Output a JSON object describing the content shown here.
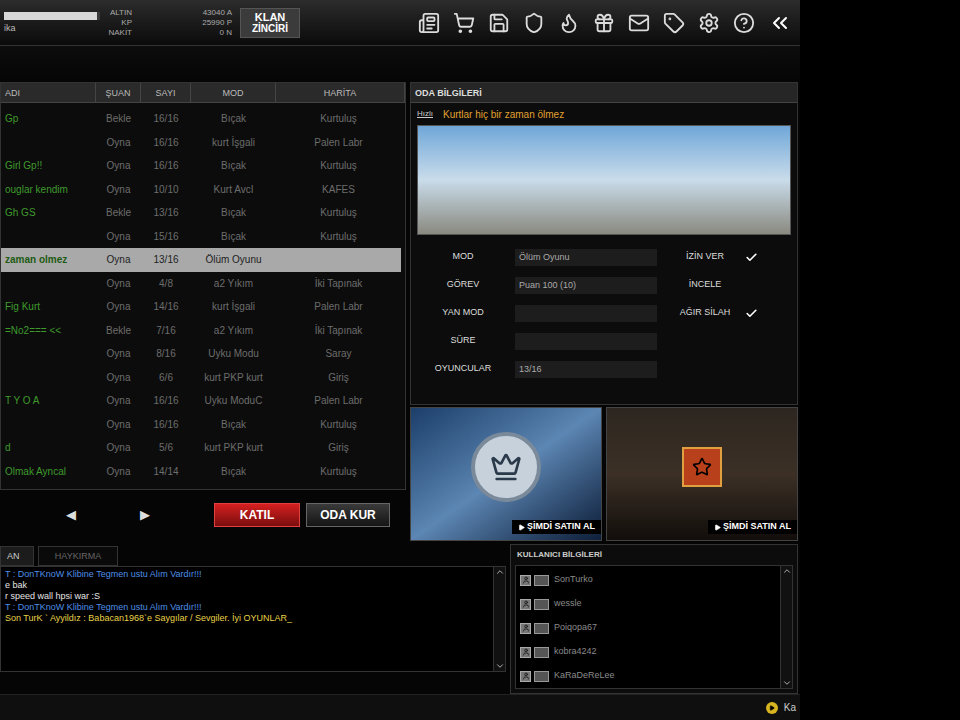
{
  "top_bar": {
    "player_name": "ika",
    "exp_bar": {
      "level": 0.97
    },
    "currencies": [
      {
        "label": "ALTIN",
        "value": "43040 A"
      },
      {
        "label": "KP",
        "value": "25990 P"
      },
      {
        "label": "NAKİT",
        "value": "0 N"
      }
    ],
    "logo": {
      "line1": "KLAN",
      "line2": "ZİNCİRİ"
    }
  },
  "room_list": {
    "columns": [
      "ADI",
      "ŞUAN",
      "SAYI",
      "MOD",
      "HARİTA"
    ],
    "rows": [
      {
        "name": "Gp",
        "status": "Bekle",
        "count": "16/16",
        "mode": "Bıçak",
        "map": "Kurtuluş",
        "selected": false
      },
      {
        "name": "",
        "status": "Oyna",
        "count": "16/16",
        "mode": "kurt İşgali",
        "map": "Palen Labr",
        "selected": false
      },
      {
        "name": "Girl Gp!!",
        "status": "Oyna",
        "count": "16/16",
        "mode": "Bıçak",
        "map": "Kurtuluş",
        "selected": false
      },
      {
        "name": "ouglar kendim",
        "status": "Oyna",
        "count": "10/10",
        "mode": "Kurt AvcI",
        "map": "KAFES",
        "selected": false
      },
      {
        "name": "Gh GS",
        "status": "Bekle",
        "count": "13/16",
        "mode": "Bıçak",
        "map": "Kurtuluş",
        "selected": false
      },
      {
        "name": "",
        "status": "Oyna",
        "count": "15/16",
        "mode": "Bıçak",
        "map": "Kurtuluş",
        "selected": false
      },
      {
        "name": "zaman olmez",
        "status": "Oyna",
        "count": "13/16",
        "mode": "Ölüm Oyunu",
        "map": "",
        "selected": true
      },
      {
        "name": "",
        "status": "Oyna",
        "count": "4/8",
        "mode": "a2 Yıkım",
        "map": "İki Tapınak",
        "selected": false
      },
      {
        "name": "Fig Kurt",
        "status": "Oyna",
        "count": "14/16",
        "mode": "kurt İşgali",
        "map": "Palen Labr",
        "selected": false
      },
      {
        "name": "=No2=== <<",
        "status": "Bekle",
        "count": "7/16",
        "mode": "a2 Yıkım",
        "map": "İki Tapınak",
        "selected": false
      },
      {
        "name": "",
        "status": "Oyna",
        "count": "8/16",
        "mode": "Uyku Modu",
        "map": "Saray",
        "selected": false
      },
      {
        "name": "",
        "status": "Oyna",
        "count": "6/6",
        "mode": "kurt PKP kurt",
        "map": "Giriş",
        "selected": false
      },
      {
        "name": "T Y O A",
        "status": "Oyna",
        "count": "16/16",
        "mode": "Uyku ModuC",
        "map": "Palen Labr",
        "selected": false
      },
      {
        "name": "",
        "status": "Oyna",
        "count": "16/16",
        "mode": "Bıçak",
        "map": "Kurtuluş",
        "selected": false
      },
      {
        "name": "d",
        "status": "Oyna",
        "count": "5/6",
        "mode": "kurt PKP kurt",
        "map": "Giriş",
        "selected": false
      },
      {
        "name": "Olmak Ayncal",
        "status": "Oyna",
        "count": "14/14",
        "mode": "Bıçak",
        "map": "Kurtuluş",
        "selected": false
      }
    ],
    "pager": {
      "prev": "◀",
      "next": "▶"
    },
    "buttons": [
      {
        "label": "KATIL",
        "kind": "primary"
      },
      {
        "label": "ODA KUR",
        "kind": "secondary"
      }
    ]
  },
  "room_info": {
    "title": "ODA BİLGİLERİ",
    "tag": "Hızlı",
    "room_name": "Kurtlar hiç bir zaman ölmez",
    "fields": [
      {
        "label": "MOD",
        "value": "Ölüm Oyunu"
      },
      {
        "label": "GÖREV",
        "value": "Puan 100 (10)"
      },
      {
        "label": "YAN MOD",
        "value": ""
      },
      {
        "label": "SÜRE",
        "value": ""
      },
      {
        "label": "OYUNCULAR",
        "value": "13/16"
      }
    ],
    "options": [
      {
        "label": "İZİN VER",
        "checked": true
      },
      {
        "label": "İNCELE",
        "checked": false
      },
      {
        "label": "AĞIR SİLAH",
        "checked": true
      }
    ]
  },
  "ads": [
    {
      "button": "ŞİMDİ SATIN AL",
      "kind": "badge"
    },
    {
      "button": "ŞİMDİ SATIN AL",
      "kind": "character"
    }
  ],
  "chat": {
    "tabs": [
      {
        "label": "AN",
        "selected": true
      },
      {
        "label": "HAYKIRMA",
        "selected": false
      }
    ],
    "messages": [
      {
        "text": "T : DonTKnoW Klibine Tegmen ustu Alım Vardır!!!",
        "color": "#4f8fe6"
      },
      {
        "text": "e bak",
        "color": "#e6e6e6"
      },
      {
        "text": "r speed wall hpsi war :S",
        "color": "#e6e6e6"
      },
      {
        "text": "T : DonTKnoW Klibine Tegmen ustu Alım Vardır!!!",
        "color": "#4f8fe6"
      },
      {
        "text": "Son TurK ` Ayyildız : Babacan1968`e Saygılar / Sevgiler. İyi OYUNLAR_",
        "color": "#e8d24a"
      }
    ]
  },
  "users": {
    "title": "KULLANICI BİLGİLERİ",
    "list": [
      {
        "name": "SonTurko"
      },
      {
        "name": "wessle"
      },
      {
        "name": "Poiqopa67"
      },
      {
        "name": "kobra4242"
      },
      {
        "name": "KaRaDeReLee"
      }
    ]
  },
  "status_bar": {
    "text": "Ka"
  }
}
